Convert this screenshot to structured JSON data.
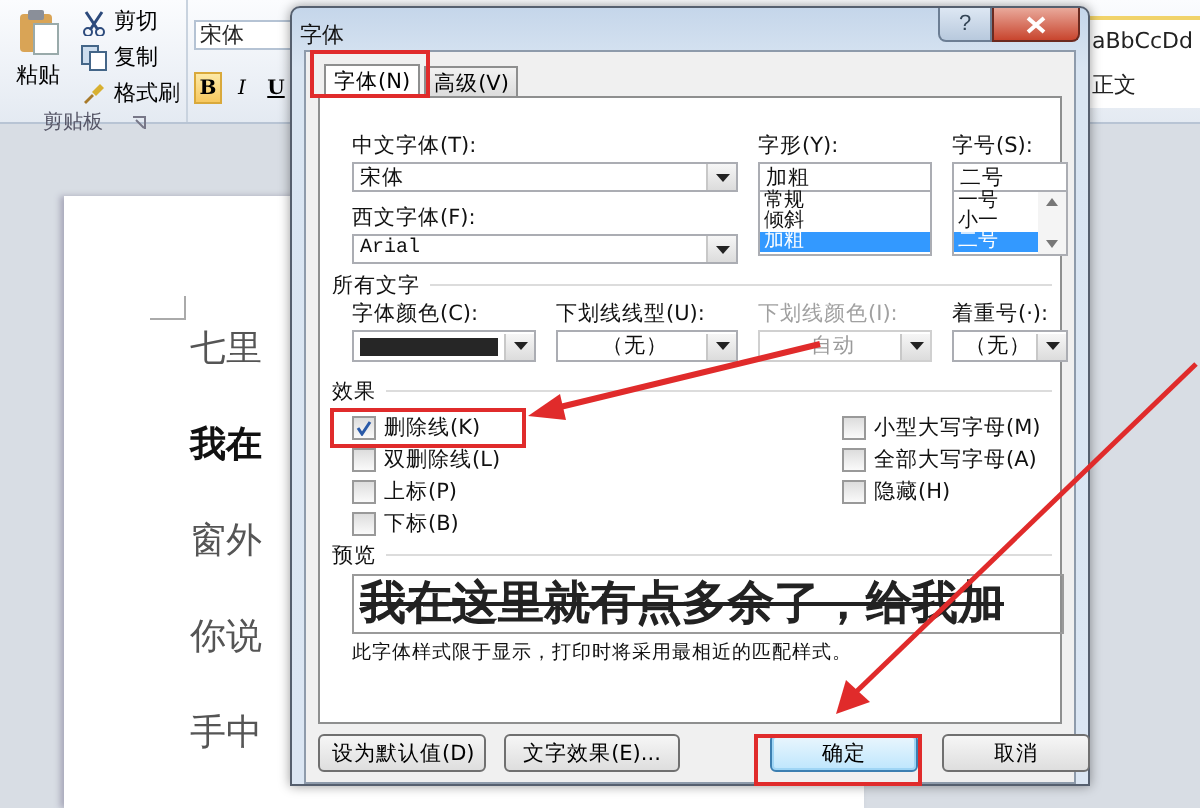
{
  "ribbon": {
    "paste": "粘贴",
    "clipboard_items": [
      {
        "kind": "cut",
        "label": "剪切"
      },
      {
        "kind": "copy",
        "label": "复制"
      },
      {
        "kind": "brush",
        "label": "格式刷"
      }
    ],
    "clipboard_label": "剪贴板",
    "font_box": "宋体",
    "format_buttons": [
      {
        "label": "B",
        "selected": true
      },
      {
        "label": "I",
        "selected": false
      },
      {
        "label": "U",
        "selected": false
      }
    ],
    "style_preview": "aBbCcDd",
    "style_name": "正文"
  },
  "document": {
    "lines": [
      {
        "text": "七里",
        "bold": false
      },
      {
        "text": "我在",
        "bold": true
      },
      {
        "text": "窗外",
        "bold": false
      },
      {
        "text": "你说",
        "bold": false
      },
      {
        "text": "手中",
        "bold": false
      }
    ]
  },
  "dialog": {
    "title": "字体",
    "help": "?",
    "tabs": [
      {
        "label": "字体(N)",
        "selected": true
      },
      {
        "label": "高级(V)",
        "selected": false
      }
    ],
    "chinese_font": {
      "label": "中文字体(T):",
      "value": "宋体"
    },
    "western_font": {
      "label": "西文字体(F):",
      "value": "Arial"
    },
    "font_style": {
      "label": "字形(Y):",
      "value": "加粗",
      "options": [
        {
          "label": "常规",
          "selected": false
        },
        {
          "label": "倾斜",
          "selected": false
        },
        {
          "label": "加粗",
          "selected": true
        }
      ]
    },
    "font_size": {
      "label": "字号(S):",
      "value": "二号",
      "options": [
        {
          "label": "一号",
          "selected": false
        },
        {
          "label": "小一",
          "selected": false
        },
        {
          "label": "二号",
          "selected": true
        }
      ]
    },
    "all_text": {
      "heading": "所有文字",
      "fields": [
        {
          "kind": "color",
          "label": "字体颜色(C):",
          "color": "#262626",
          "disabled": false
        },
        {
          "kind": "select",
          "label": "下划线线型(U):",
          "value": "（无）",
          "disabled": false
        },
        {
          "kind": "select",
          "label": "下划线颜色(I):",
          "value": "自动",
          "disabled": true
        },
        {
          "kind": "select",
          "label": "着重号(·):",
          "value": "（无）",
          "disabled": false
        }
      ]
    },
    "effects": {
      "heading": "效果",
      "left": [
        {
          "label": "删除线(K)",
          "checked": true
        },
        {
          "label": "双删除线(L)",
          "checked": false
        },
        {
          "label": "上标(P)",
          "checked": false
        },
        {
          "label": "下标(B)",
          "checked": false
        }
      ],
      "right": [
        {
          "label": "小型大写字母(M)",
          "checked": false
        },
        {
          "label": "全部大写字母(A)",
          "checked": false
        },
        {
          "label": "隐藏(H)",
          "checked": false
        }
      ]
    },
    "preview": {
      "heading": "预览",
      "text": "我在这里就有点多余了，给我加",
      "note": "此字体样式限于显示，打印时将采用最相近的匹配样式。"
    },
    "buttons": [
      {
        "label": "设为默认值(D)",
        "default": false
      },
      {
        "label": "文字效果(E)...",
        "default": false
      },
      {
        "label": "确定",
        "default": true
      },
      {
        "label": "取消",
        "default": false
      }
    ]
  }
}
